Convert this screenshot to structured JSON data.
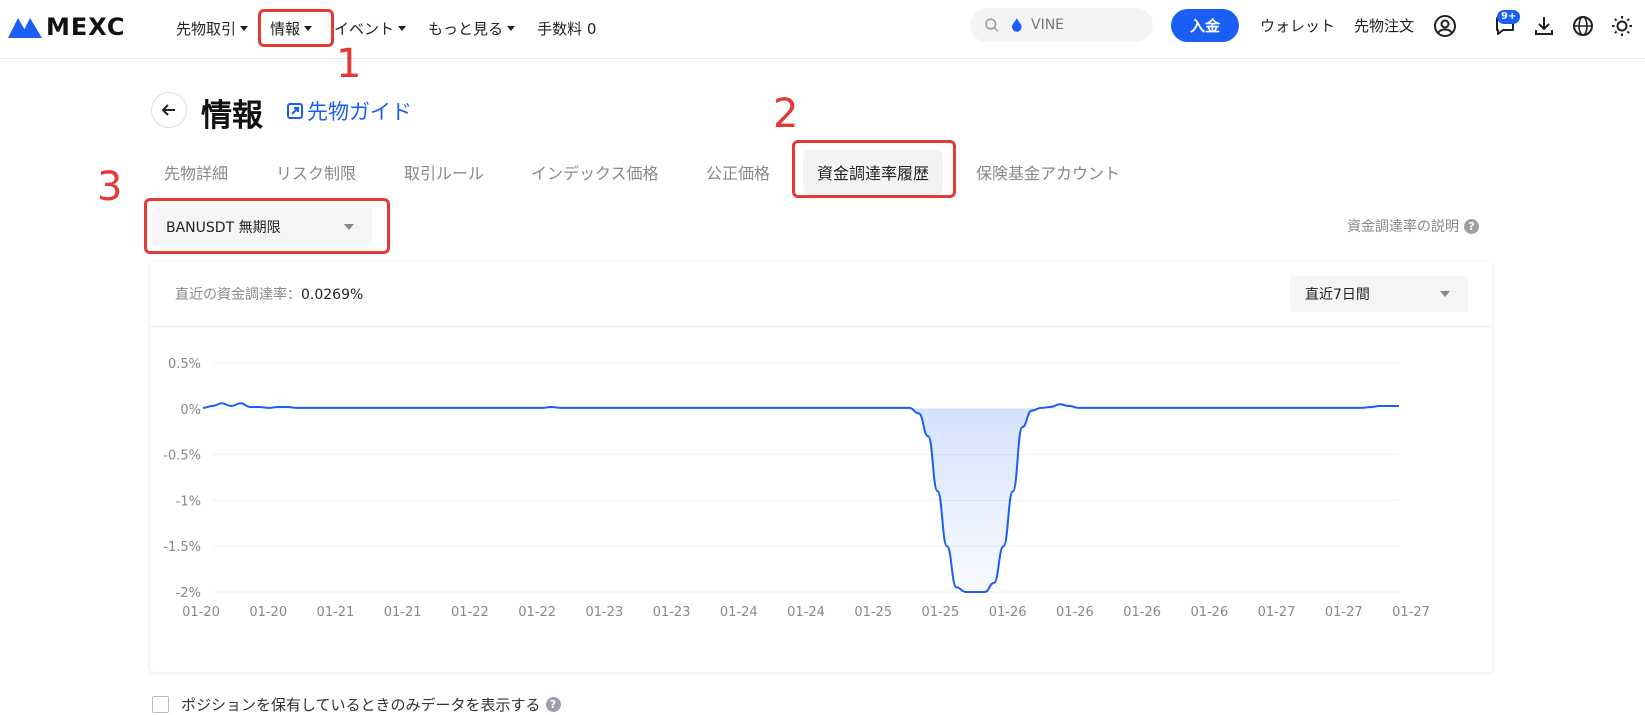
{
  "brand": {
    "name": "MEXC",
    "color": "#1a5ef5"
  },
  "nav": [
    {
      "label": "先物取引",
      "dropdown": true
    },
    {
      "label": "情報",
      "dropdown": true
    },
    {
      "label": "イベント",
      "dropdown": true
    },
    {
      "label": "もっと見る",
      "dropdown": true
    },
    {
      "label": "手数料 0",
      "dropdown": false
    }
  ],
  "search": {
    "placeholder": "VINE"
  },
  "header": {
    "deposit_label": "入金",
    "wallet_label": "ウォレット",
    "orders_label": "先物注文",
    "notification_badge": "9+"
  },
  "page": {
    "title": "情報",
    "guide_label": "先物ガイド",
    "tabs": [
      {
        "label": "先物詳細",
        "active": false
      },
      {
        "label": "リスク制限",
        "active": false
      },
      {
        "label": "取引ルール",
        "active": false
      },
      {
        "label": "インデックス価格",
        "active": false
      },
      {
        "label": "公正価格",
        "active": false
      },
      {
        "label": "資金調達率履歴",
        "active": true
      },
      {
        "label": "保険基金アカウント",
        "active": false
      }
    ],
    "symbol_select": "BANUSDT 無期限",
    "explain_label": "資金調達率の説明",
    "recent_label": "直近の資金調達率：",
    "recent_value": "0.0269%",
    "range_select": "直近7日間",
    "footer_checkbox_label": "ポジションを保有しているときのみデータを表示する"
  },
  "annotations": [
    {
      "number": "1"
    },
    {
      "number": "2"
    },
    {
      "number": "3"
    }
  ],
  "chart_data": {
    "type": "area",
    "y_ticks": [
      {
        "value": 0.5,
        "label": "0.5%"
      },
      {
        "value": 0,
        "label": "0%"
      },
      {
        "value": -0.5,
        "label": "-0.5%"
      },
      {
        "value": -1,
        "label": "-1%"
      },
      {
        "value": -1.5,
        "label": "-1.5%"
      },
      {
        "value": -2,
        "label": "-2%"
      }
    ],
    "x_tick_labels": [
      "01-20",
      "01-20",
      "01-21",
      "01-21",
      "01-22",
      "01-22",
      "01-23",
      "01-23",
      "01-24",
      "01-24",
      "01-25",
      "01-25",
      "01-26",
      "01-26",
      "01-26",
      "01-26",
      "01-27",
      "01-27",
      "01-27"
    ],
    "ylim": [
      -2,
      0.5
    ],
    "grid": true,
    "series": [
      {
        "color": "#1a5ef5",
        "values": [
          0.01,
          0.03,
          0.06,
          0.03,
          0.06,
          0.02,
          0.02,
          0.01,
          0.02,
          0.02,
          0.01,
          0.01,
          0.01,
          0.01,
          0.01,
          0.01,
          0.01,
          0.01,
          0.01,
          0.01,
          0.01,
          0.01,
          0.01,
          0.01,
          0.01,
          0.01,
          0.01,
          0.01,
          0.01,
          0.01,
          0.01,
          0.01,
          0.01,
          0.01,
          0.01,
          0.01,
          0.01,
          0.02,
          0.01,
          0.01,
          0.01,
          0.01,
          0.01,
          0.01,
          0.01,
          0.01,
          0.01,
          0.01,
          0.01,
          0.01,
          0.01,
          0.01,
          0.01,
          0.01,
          0.01,
          0.01,
          0.01,
          0.01,
          0.01,
          0.01,
          0.01,
          0.01,
          0.01,
          0.01,
          0.01,
          0.01,
          0.01,
          0.01,
          0.01,
          0.01,
          0.01,
          0.01,
          0.01,
          0.01,
          0.01,
          0.01,
          -0.05,
          -0.3,
          -0.9,
          -1.5,
          -1.95,
          -2,
          -2,
          -2,
          -1.9,
          -1.5,
          -0.9,
          -0.2,
          -0.02,
          0.01,
          0.02,
          0.05,
          0.03,
          0.01,
          0.01,
          0.01,
          0.01,
          0.01,
          0.01,
          0.01,
          0.01,
          0.01,
          0.01,
          0.01,
          0.01,
          0.01,
          0.01,
          0.01,
          0.01,
          0.01,
          0.01,
          0.01,
          0.01,
          0.01,
          0.01,
          0.01,
          0.01,
          0.01,
          0.01,
          0.01,
          0.01,
          0.01,
          0.01,
          0.01,
          0.02,
          0.03,
          0.03,
          0.03
        ]
      }
    ]
  }
}
